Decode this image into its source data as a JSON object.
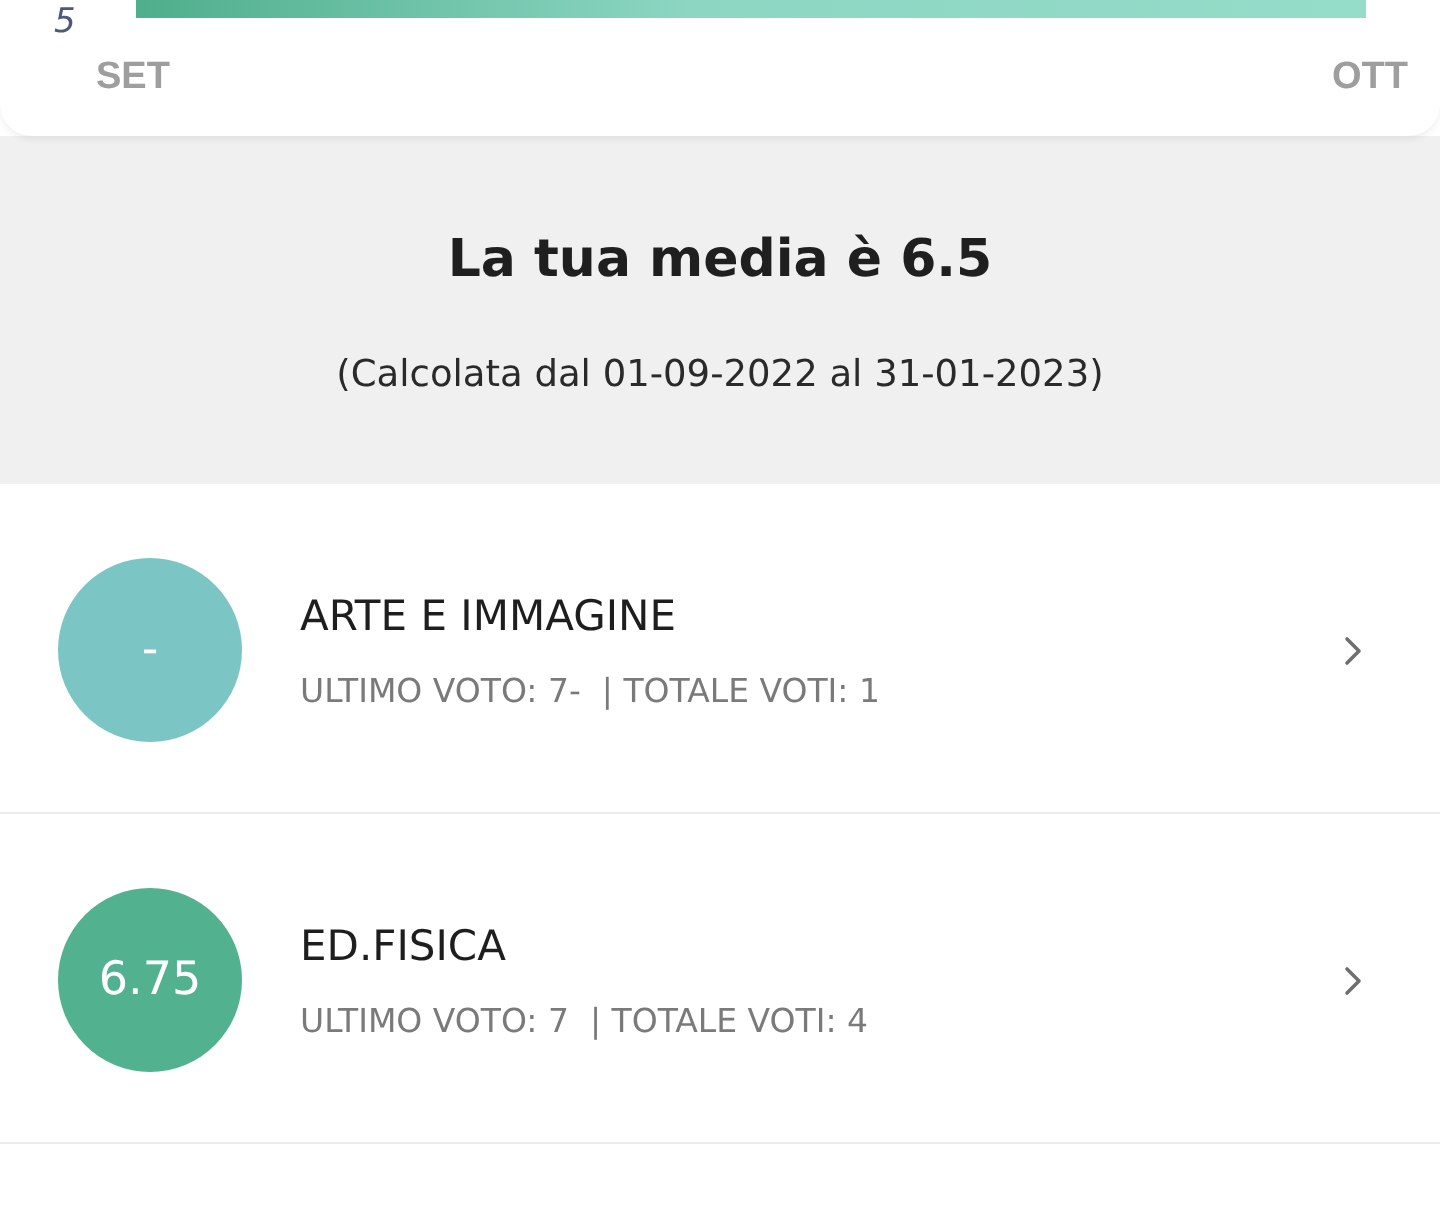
{
  "chart": {
    "y_tick": "5",
    "x_labels": [
      "SET",
      "OTT"
    ]
  },
  "average": {
    "title": "La tua media è 6.5",
    "period": "(Calcolata dal 01-09-2022 al 31-01-2023)"
  },
  "subjects": [
    {
      "name": "ARTE E IMMAGINE",
      "grade": "-",
      "color": "#7cc5c5",
      "details": "ULTIMO VOTO: 7-  | TOTALE VOTI: 1"
    },
    {
      "name": "ED.FISICA",
      "grade": "6.75",
      "color": "#52b18f",
      "details": "ULTIMO VOTO: 7  | TOTALE VOTI: 4"
    }
  ]
}
